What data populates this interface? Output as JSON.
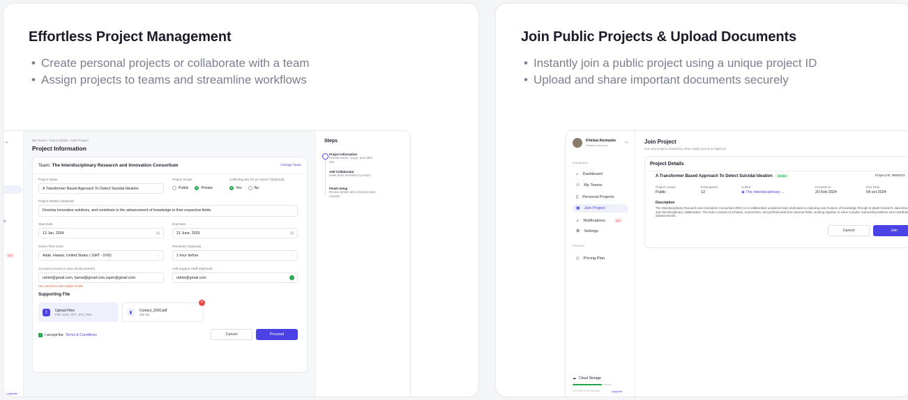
{
  "left": {
    "title": "Effortless Project Management",
    "bullets": [
      "Create personal projects or collaborate with a team",
      "Assign projects to teams and streamline workflows"
    ],
    "mock": {
      "breadcrumb": "My Teams  ›  Team Details  ›  Start Project",
      "page_title": "Project Information",
      "team_prefix": "Team:",
      "team_name": "The Interdisciplinary Research and Innovation Consortium",
      "change_team": "Change Team",
      "project_name_label": "Project Name",
      "project_name_value": "A Transformer Based Approach To Detect Suicidal Ideation",
      "scope_label": "Project Scope",
      "scope_public": "Public",
      "scope_private": "Private",
      "collect_label": "Collecting doc for an event? (Optional)",
      "yes": "Yes",
      "no": "No",
      "details_label": "Project Details (Optional)",
      "details_value": "Develop innovative solutions, and contribute to the advancement of knowledge in their respective fields.",
      "start_label": "Start Date",
      "start_value": "12 Jan, 2024",
      "end_label": "End Date",
      "end_value": "21 June, 2025",
      "tz_label": "Select Time Zone",
      "tz_value": "Adak, Hawaii, United States ( GMT - 9:00)",
      "reminder_label": "Reminder (Optional)",
      "reminder_value": "1 hour before",
      "cohost_label": "Co-Host (Access to view all documents)",
      "cohost_value": "rahim@gmail.com, kamal@gmail.com,sujon@gmail.com",
      "cohost_error": "Use comma to add multiple emails",
      "support_label": "Add Support Staff (Optional)",
      "support_value": "rahim@gmail.com",
      "supporting_file": "Supporting File",
      "upload_title": "Upload Files",
      "upload_types": "PDF, DOC, PPT, JPG, PNG",
      "file_name": "Contact_2020.pdf",
      "file_size": "456 KB",
      "accept_prefix": "I accept the",
      "accept_link": "Terms & Conditions",
      "cancel": "Cancel",
      "proceed": "Proceed",
      "steps_title": "Steps",
      "steps": [
        {
          "title": "Project Information",
          "desc": "Provide name, scope, and other info."
        },
        {
          "title": "Add Collaborator",
          "desc": "Invite team members by email."
        },
        {
          "title": "Finish Setup",
          "desc": "Review details and complete team creation."
        }
      ],
      "side_frag": [
        "m",
        "oject",
        "Upgrade"
      ],
      "side_badge": "425"
    }
  },
  "right": {
    "title": "Join Public Projects & Upload Documents",
    "bullets": [
      "Instantly join a public project using a unique project ID",
      "Upload and share important documents securely"
    ],
    "mock": {
      "user_name": "Khinkal Atomadze",
      "user_role": "Platinum Account",
      "nav_section": "Navigation",
      "nav": [
        "Dashboard",
        "My Teams",
        "Personal Projects",
        "Join Project",
        "Notifications",
        "Settings"
      ],
      "notif_badge": "425",
      "finance": "Finance",
      "pricing": "Pricing Plan",
      "storage": "Cloud Storage",
      "storage_used": "12.5 GB of 15 GB used",
      "upgrade": "Upgrade",
      "storage_fraction": 0.75,
      "page_title": "Join Project",
      "page_sub": "Join any project created by other easily just by 9 Digits ID.",
      "panel_title": "Project Details",
      "project_name": "A Transformer Based Approach To Detect Suicidal Ideation",
      "status": "Active",
      "project_id": "Project ID: 3592023",
      "scope_label": "Project Scope",
      "scope_value": "Public",
      "participants_label": "Participants",
      "participants_value": "12",
      "author_label": "Author",
      "author_value": "The Interdisciplinary ...",
      "created_label": "Created on",
      "created_value": "20 Feb 2024",
      "due_label": "Due Date",
      "due_value": "04 oct 2024",
      "desc_label": "Description",
      "desc_value": "The Interdisciplinary Research and Innovation Consortium (IRIC) is a collaborative academic team dedicated to exploring new frontiers of knowledge through in-depth research, data-driven insights, and interdisciplinary collaboration. The team consists of scholars, researchers, and professionals from diverse fields, working together to solve complex real-world problems and contribute to academic advancements.",
      "cancel": "Cancel",
      "join": "Join"
    }
  }
}
